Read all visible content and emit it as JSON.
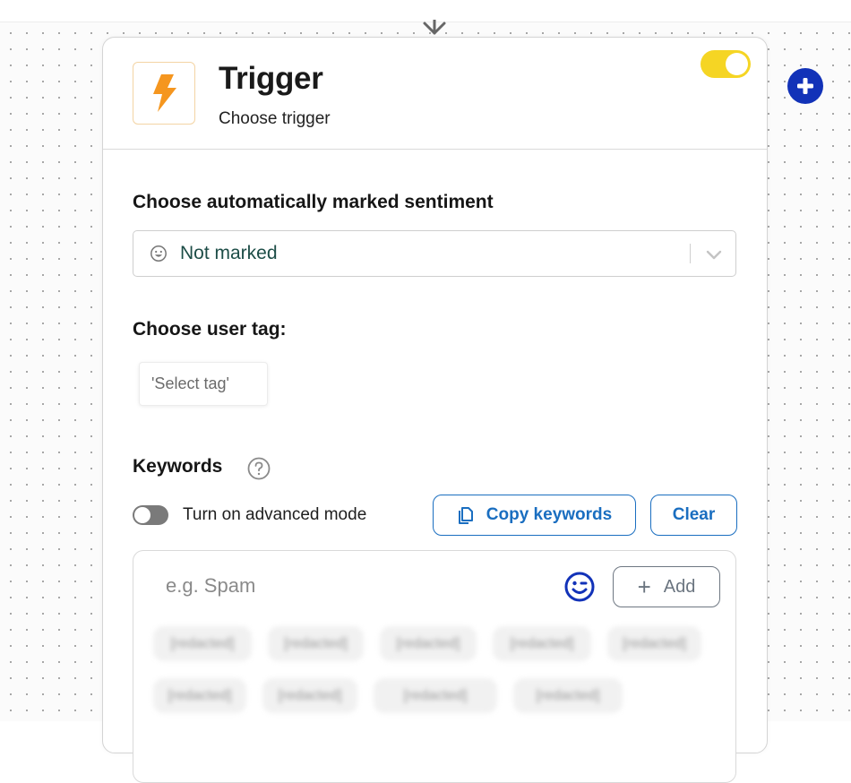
{
  "node": {
    "title": "Trigger",
    "subtitle": "Choose trigger",
    "enabled": true,
    "icon": "lightning-bolt-icon",
    "accent_color": "#f5961f",
    "toggle_color": "#f5d524"
  },
  "sentiment": {
    "label": "Choose automatically marked sentiment",
    "selected": "Not marked",
    "icon": "smiley-icon"
  },
  "user_tag": {
    "label": "Choose user tag:",
    "placeholder": "'Select tag'"
  },
  "keywords": {
    "label": "Keywords",
    "help_icon": "question-circle-icon",
    "advanced_mode_label": "Turn on advanced mode",
    "advanced_mode_on": false,
    "copy_button": "Copy keywords",
    "clear_button": "Clear",
    "input_placeholder": "e.g. Spam",
    "add_button": "Add",
    "emoji_icon": "wink-emoji-icon",
    "chips_blurred": true,
    "chip_rows": [
      [
        "[redacted]",
        "[redacted]",
        "[redacted]",
        "[redacted]",
        "[redacted]"
      ],
      [
        "[redacted]",
        "[redacted]",
        "[redacted]",
        "[redacted]"
      ]
    ]
  },
  "canvas": {
    "add_node_icon": "plus-circle-icon",
    "add_node_color": "#1232b8",
    "connector_icon": "arrow-down-icon"
  }
}
